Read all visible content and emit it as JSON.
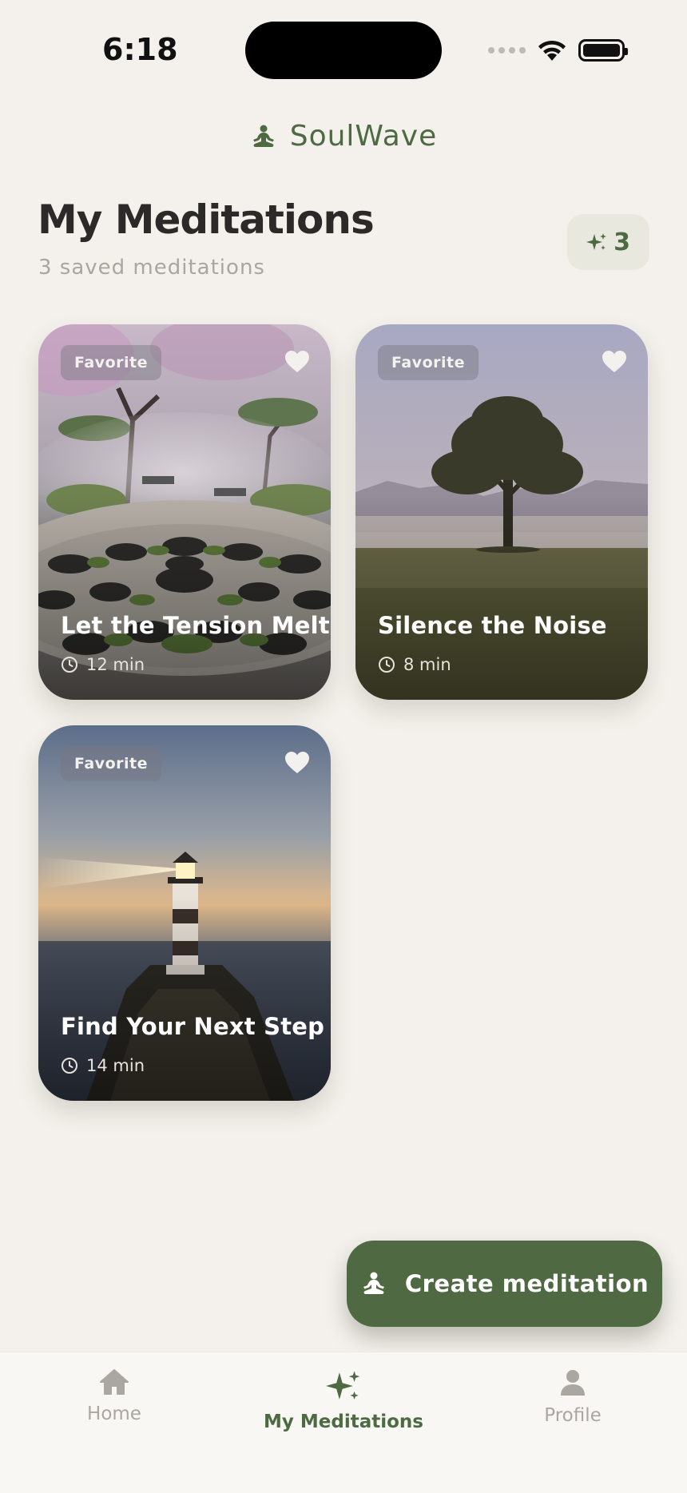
{
  "status_bar": {
    "time": "6:18"
  },
  "brand": {
    "name": "SoulWave",
    "icon": "meditation-icon"
  },
  "header": {
    "title": "My Meditations",
    "subtitle": "3 saved meditations",
    "count_badge": "3",
    "count_badge_icon": "sparkle-icon"
  },
  "cards": [
    {
      "tag": "Favorite",
      "title": "Let the Tension Melt",
      "duration": "12 min",
      "scene": "zen-garden-stones",
      "favorited": true
    },
    {
      "tag": "Favorite",
      "title": "Silence the Noise",
      "duration": "8 min",
      "scene": "misty-tree-meadow",
      "favorited": true
    },
    {
      "tag": "Favorite",
      "title": "Find Your Next Step",
      "duration": "14 min",
      "scene": "lighthouse-sunset",
      "favorited": true
    }
  ],
  "create_button": {
    "label": "Create meditation",
    "icon": "meditation-icon"
  },
  "tab_bar": {
    "items": [
      {
        "label": "Home",
        "icon": "home-icon",
        "active": false
      },
      {
        "label": "My Meditations",
        "icon": "sparkle-icon",
        "active": true
      },
      {
        "label": "Profile",
        "icon": "person-icon",
        "active": false
      }
    ]
  },
  "colors": {
    "background": "#f4f1ec",
    "accent": "#4d6a42",
    "accent_button": "#4f6a43",
    "muted_text": "#a9a6a0",
    "title_text": "#2b2a28"
  }
}
